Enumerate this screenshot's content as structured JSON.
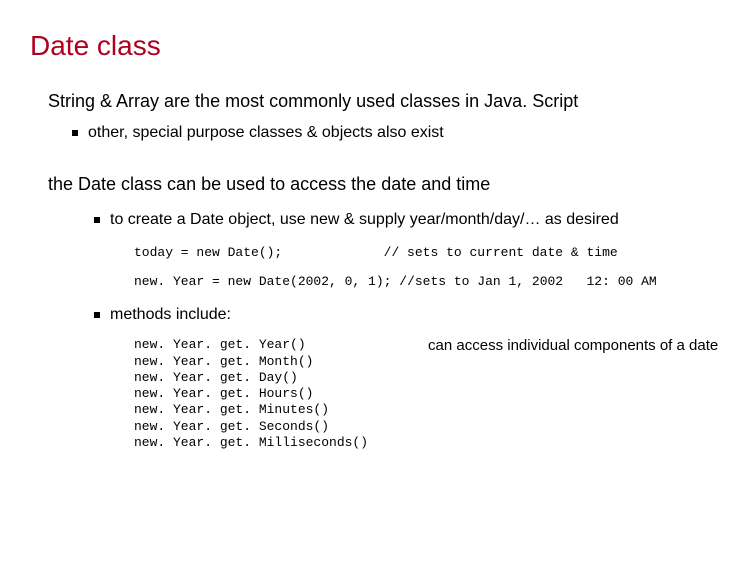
{
  "title": "Date class",
  "intro_line": "String & Array are the most commonly used classes in Java. Script",
  "intro_bullet": "other, special purpose classes & objects also exist",
  "section2": "the Date class can be used to access the date and time",
  "create_bullet": "to create a Date object, use new & supply year/month/day/… as desired",
  "code_lines": {
    "l1_left": "today = new Date();",
    "l1_right": "// sets to current date & time",
    "l2_left": "new. Year = new Date(2002, 0, 1);",
    "l2_right": "//sets to Jan 1, 2002   12: 00 AM"
  },
  "methods_bullet": "methods include:",
  "methods": [
    "new. Year. get. Year()",
    "new. Year. get. Month()",
    "new. Year. get. Day()",
    "new. Year. get. Hours()",
    "new. Year. get. Minutes()",
    "new. Year. get. Seconds()",
    "new. Year. get. Milliseconds()"
  ],
  "methods_note": "can access individual components of a date"
}
